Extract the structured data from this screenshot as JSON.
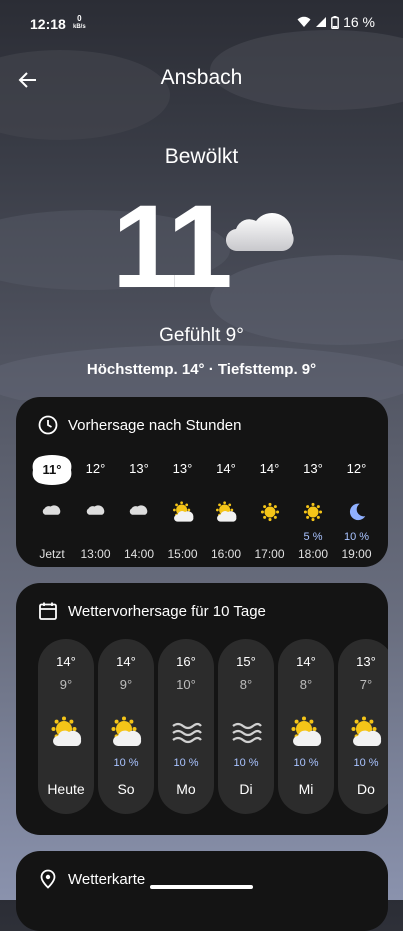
{
  "status": {
    "time": "12:18",
    "kbs_value": "0",
    "kbs_unit": "kB/s",
    "battery": "16 %"
  },
  "header": {
    "city": "Ansbach"
  },
  "current": {
    "condition": "Bewölkt",
    "temp": "11",
    "feels_like": "Gefühlt 9°",
    "minmax": "Höchsttemp. 14° · Tiefsttemp. 9°"
  },
  "hourly": {
    "title": "Vorhersage nach Stunden",
    "items": [
      {
        "temp": "11°",
        "icon": "cloud-icon",
        "precip": "",
        "time": "Jetzt"
      },
      {
        "temp": "12°",
        "icon": "cloud-icon",
        "precip": "",
        "time": "13:00"
      },
      {
        "temp": "13°",
        "icon": "cloud-icon",
        "precip": "",
        "time": "14:00"
      },
      {
        "temp": "13°",
        "icon": "sun-cloud-icon",
        "precip": "",
        "time": "15:00"
      },
      {
        "temp": "14°",
        "icon": "sun-cloud-icon",
        "precip": "",
        "time": "16:00"
      },
      {
        "temp": "14°",
        "icon": "sun-icon",
        "precip": "",
        "time": "17:00"
      },
      {
        "temp": "13°",
        "icon": "sun-icon",
        "precip": "5 %",
        "time": "18:00"
      },
      {
        "temp": "12°",
        "icon": "moon-icon",
        "precip": "10 %",
        "time": "19:00"
      }
    ]
  },
  "daily": {
    "title": "Wettervorhersage für 10 Tage",
    "items": [
      {
        "hi": "14°",
        "lo": "9°",
        "icon": "sun-cloud-icon",
        "precip": "",
        "day": "Heute"
      },
      {
        "hi": "14°",
        "lo": "9°",
        "icon": "sun-cloud-icon",
        "precip": "10 %",
        "day": "So"
      },
      {
        "hi": "16°",
        "lo": "10°",
        "icon": "wind-icon",
        "precip": "10 %",
        "day": "Mo"
      },
      {
        "hi": "15°",
        "lo": "8°",
        "icon": "wind-icon",
        "precip": "10 %",
        "day": "Di"
      },
      {
        "hi": "14°",
        "lo": "8°",
        "icon": "sun-cloud-icon",
        "precip": "10 %",
        "day": "Mi"
      },
      {
        "hi": "13°",
        "lo": "7°",
        "icon": "sun-cloud-icon",
        "precip": "10 %",
        "day": "Do"
      }
    ]
  },
  "map": {
    "title": "Wetterkarte"
  },
  "colors": {
    "card": "#141414",
    "day_pill": "#2c2c2c",
    "precip": "#a9c3ff",
    "sun": "#f5c518"
  }
}
